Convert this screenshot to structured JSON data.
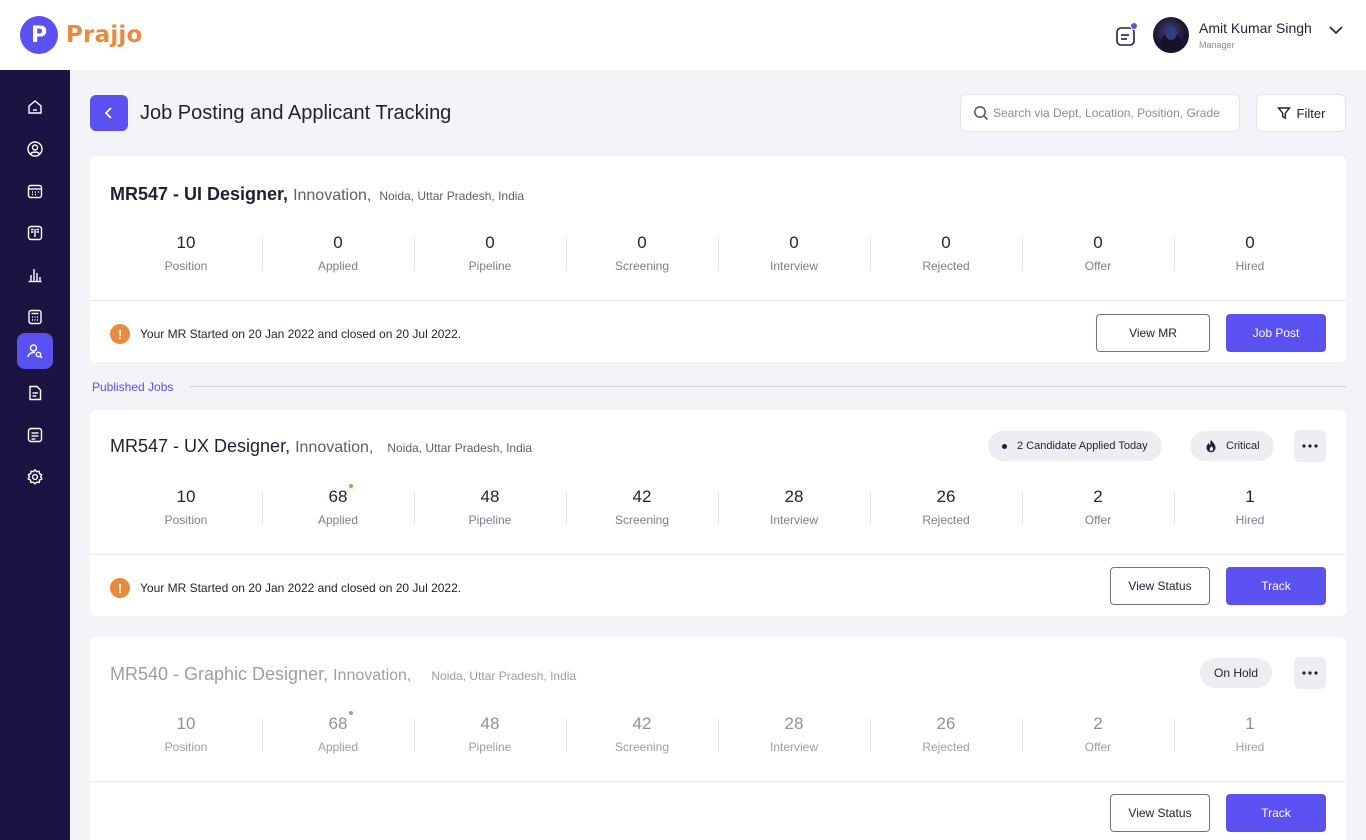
{
  "app": {
    "name": "Prajjo",
    "logo_letter": "P"
  },
  "user": {
    "name": "Amit Kumar Singh",
    "role": "Manager"
  },
  "colors": {
    "primary": "#5b50f0",
    "sidebar": "#1b1443",
    "warning": "#e98a3c",
    "applied_dot_active": "#e98a3c",
    "applied_dot_muted": "#9b9ea8"
  },
  "sidebar": {
    "items": [
      {
        "icon": "home-icon"
      },
      {
        "icon": "user-icon"
      },
      {
        "icon": "calendar-icon"
      },
      {
        "icon": "book-icon"
      },
      {
        "icon": "chart-icon"
      },
      {
        "icon": "calculator-icon"
      },
      {
        "icon": "recruitment-icon",
        "active": true
      },
      {
        "icon": "document-icon"
      },
      {
        "icon": "list-icon"
      },
      {
        "icon": "settings-icon"
      }
    ]
  },
  "header": {
    "title": "Job Posting and Applicant Tracking",
    "search_placeholder": "Search via Dept, Location, Position, Grade",
    "filter_label": "Filter"
  },
  "section_label": "Published Jobs",
  "jobs": [
    {
      "code_title": "MR547 - UI Designer,",
      "department": "Innovation,",
      "location": "Noida, Uttar Pradesh, India",
      "stats": [
        {
          "value": "10",
          "label": "Position"
        },
        {
          "value": "0",
          "label": "Applied"
        },
        {
          "value": "0",
          "label": "Pipeline"
        },
        {
          "value": "0",
          "label": "Screening"
        },
        {
          "value": "0",
          "label": "Interview"
        },
        {
          "value": "0",
          "label": "Rejected"
        },
        {
          "value": "0",
          "label": "Offer"
        },
        {
          "value": "0",
          "label": "Hired"
        }
      ],
      "notice": "Your MR Started on 20 Jan 2022 and closed on 20 Jul 2022.",
      "secondary_action": "View MR",
      "primary_action": "Job Post"
    },
    {
      "code_title": "MR547 - UX Designer,",
      "department": "Innovation,",
      "location": "Noida, Uttar Pradesh, India",
      "badge_applied_today": "2 Candidate Applied Today",
      "badge_priority": "Critical",
      "stats": [
        {
          "value": "10",
          "label": "Position"
        },
        {
          "value": "68",
          "label": "Applied"
        },
        {
          "value": "48",
          "label": "Pipeline"
        },
        {
          "value": "42",
          "label": "Screening"
        },
        {
          "value": "28",
          "label": "Interview"
        },
        {
          "value": "26",
          "label": "Rejected"
        },
        {
          "value": "2",
          "label": "Offer"
        },
        {
          "value": "1",
          "label": "Hired"
        }
      ],
      "notice": "Your MR Started on 20 Jan 2022 and closed on 20 Jul 2022.",
      "secondary_action": "View Status",
      "primary_action": "Track"
    },
    {
      "code_title": "MR540 - Graphic Designer,",
      "department": "Innovation,",
      "location": "Noida, Uttar Pradesh, India",
      "status_badge": "On Hold",
      "stats": [
        {
          "value": "10",
          "label": "Position"
        },
        {
          "value": "68",
          "label": "Applied"
        },
        {
          "value": "48",
          "label": "Pipeline"
        },
        {
          "value": "42",
          "label": "Screening"
        },
        {
          "value": "28",
          "label": "Interview"
        },
        {
          "value": "26",
          "label": "Rejected"
        },
        {
          "value": "2",
          "label": "Offer"
        },
        {
          "value": "1",
          "label": "Hired"
        }
      ],
      "secondary_action": "View Status",
      "primary_action": "Track"
    }
  ]
}
